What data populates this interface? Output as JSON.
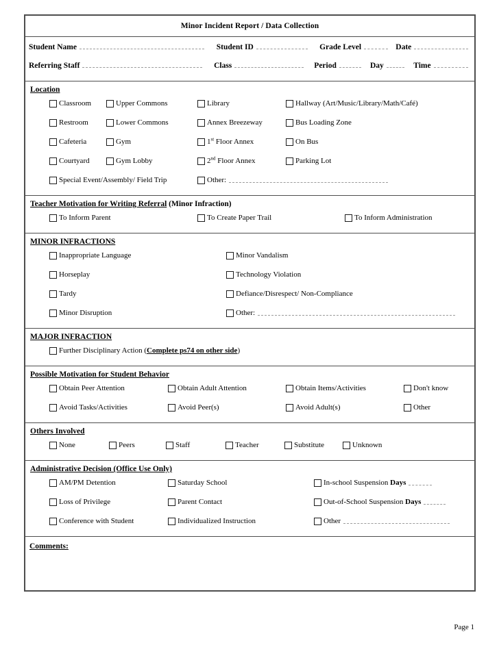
{
  "document": {
    "title": "Minor Incident Report / Data Collection",
    "footer": "Page 1"
  },
  "identity": {
    "row1": {
      "student_name_label": "Student Name",
      "student_id_label": "Student ID",
      "grade_level_label": "Grade Level",
      "date_label": "Date"
    },
    "row2": {
      "referring_staff_label": "Referring Staff",
      "class_label": "Class",
      "period_label": "Period",
      "day_label": "Day",
      "time_label": "Time"
    }
  },
  "location": {
    "heading": "Location",
    "items": [
      {
        "label": "Classroom",
        "col": 0,
        "row": 0
      },
      {
        "label": "Upper Commons",
        "col": 1,
        "row": 0
      },
      {
        "label": "Library",
        "col": 2,
        "row": 0
      },
      {
        "label": "Hallway (Art/Music/Library/Math/Café)",
        "col": 3,
        "row": 0
      },
      {
        "label": "Restroom",
        "col": 0,
        "row": 1
      },
      {
        "label": "Lower Commons",
        "col": 1,
        "row": 1
      },
      {
        "label": "Annex Breezeway",
        "col": 2,
        "row": 1
      },
      {
        "label": "Bus Loading Zone",
        "col": 3,
        "row": 1
      },
      {
        "label": "Cafeteria",
        "col": 0,
        "row": 2
      },
      {
        "label": "Gym",
        "col": 1,
        "row": 2
      },
      {
        "label": "1st Floor Annex",
        "col": 2,
        "row": 2,
        "sup": "st",
        "base": "1",
        "tail": " Floor Annex"
      },
      {
        "label": "On Bus",
        "col": 3,
        "row": 2
      },
      {
        "label": "Courtyard",
        "col": 0,
        "row": 3
      },
      {
        "label": "Gym Lobby",
        "col": 1,
        "row": 3
      },
      {
        "label": "2nd Floor Annex",
        "col": 2,
        "row": 3,
        "sup": "nd",
        "base": "2",
        "tail": " Floor Annex"
      },
      {
        "label": "Parking Lot",
        "col": 3,
        "row": 3
      },
      {
        "label": "Special Event/Assembly/ Field Trip",
        "col": 0,
        "row": 4
      }
    ],
    "other_label": "Other:"
  },
  "teacher_motivation": {
    "heading_underlined": "Teacher  Motivation for Writing Referral",
    "heading_plain": " (Minor Infraction)",
    "items": [
      {
        "label": "To Inform Parent"
      },
      {
        "label": "To Create  Paper Trail"
      },
      {
        "label": "To Inform Administration"
      }
    ]
  },
  "minor_infractions": {
    "heading": "MINOR INFRACTIONS",
    "left_items": [
      {
        "label": "Inappropriate Language"
      },
      {
        "label": "Horseplay"
      },
      {
        "label": "Tardy"
      },
      {
        "label": "Minor Disruption"
      }
    ],
    "right_items": [
      {
        "label": "Minor Vandalism"
      },
      {
        "label": "Technology Violation"
      },
      {
        "label": "Defiance/Disrespect/ Non-Compliance"
      },
      {
        "label": "Other:"
      }
    ]
  },
  "major_infraction": {
    "heading": "MAJOR INFRACTION",
    "item_prefix": "Further Disciplinary Action (",
    "item_emphasis": "Complete ps74 on other side",
    "item_suffix": ")"
  },
  "possible_motivation": {
    "heading": "Possible Motivation for Student Behavior",
    "items": [
      {
        "label": "Obtain Peer Attention",
        "col": 0,
        "row": 0
      },
      {
        "label": "Obtain Adult Attention",
        "col": 1,
        "row": 0
      },
      {
        "label": "Obtain Items/Activities",
        "col": 2,
        "row": 0
      },
      {
        "label": "Don't know",
        "col": 3,
        "row": 0
      },
      {
        "label": "Avoid Tasks/Activities",
        "col": 0,
        "row": 1
      },
      {
        "label": "Avoid Peer(s)",
        "col": 1,
        "row": 1
      },
      {
        "label": "Avoid Adult(s)",
        "col": 2,
        "row": 1
      },
      {
        "label": "Other",
        "col": 3,
        "row": 1
      }
    ]
  },
  "others_involved": {
    "heading": "Others Involved",
    "items": [
      {
        "label": "None"
      },
      {
        "label": "Peers"
      },
      {
        "label": "Staff"
      },
      {
        "label": "Teacher"
      },
      {
        "label": "Substitute"
      },
      {
        "label": "Unknown"
      }
    ]
  },
  "administrative_decision": {
    "heading": "Administrative Decision (Office Use Only)",
    "col1": [
      {
        "label": "AM/PM Detention"
      },
      {
        "label": "Loss of Privilege"
      },
      {
        "label": "Conference with Student"
      }
    ],
    "col2": [
      {
        "label": "Saturday School"
      },
      {
        "label": "Parent Contact"
      },
      {
        "label": "Individualized Instruction"
      }
    ],
    "col3": [
      {
        "label": "In-school Suspension ",
        "days_label": "Days"
      },
      {
        "label": "Out-of-School Suspension ",
        "days_label": "Days"
      },
      {
        "label": "Other"
      }
    ]
  },
  "comments": {
    "label": "Comments:"
  }
}
